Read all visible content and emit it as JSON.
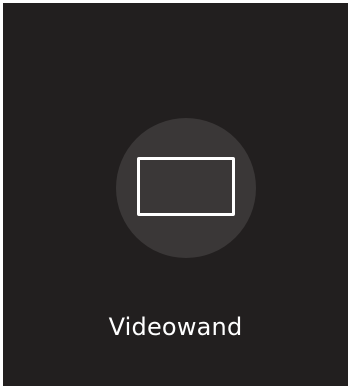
{
  "tile": {
    "label": "Videowand",
    "icon": "single-screen-icon",
    "colors": {
      "background": "#221f1f",
      "circle": "#3a3737",
      "icon_stroke": "#ffffff",
      "label": "#ffffff"
    }
  }
}
